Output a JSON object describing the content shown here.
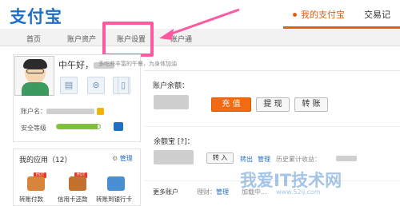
{
  "header": {
    "logo_text": "支付宝",
    "nav_active": "我的支付宝",
    "nav_next": "交易记"
  },
  "subnav": {
    "items": [
      "首页",
      "账户资产",
      "账户设置",
      "账户通"
    ]
  },
  "profile": {
    "greeting": "中午好，",
    "greeting_sub": "多吃些丰富的午餐，为身体加油",
    "account_label": "账户名：",
    "level_label": "安全等级",
    "level_fill": 0.95,
    "icons": [
      "id-card-icon",
      "certificate-icon",
      "shield-icon",
      "phone-icon"
    ]
  },
  "apps": {
    "title": "我的应用（12）",
    "manage": "管理",
    "hot": "HOT",
    "items": [
      {
        "label": "转账付款",
        "color": "#d9843b"
      },
      {
        "label": "信用卡还款",
        "color": "#c2722e"
      },
      {
        "label": "转账到银行卡",
        "color": "#4a8fd1"
      }
    ]
  },
  "balance": {
    "label": "账户余额：",
    "btn_recharge": "充 值",
    "btn_withdraw": "提 现",
    "btn_transfer": "转 账"
  },
  "yuebao": {
    "label": "余额宝 [?]：",
    "btn_in": "转 入",
    "out": "转出",
    "manage": "管理",
    "history": "历史累计收益："
  },
  "more": {
    "label": "更多账户",
    "finance": "理财：",
    "manage": "管理",
    "extra": "加载中..."
  },
  "watermark": {
    "main": "我爱IT技术网",
    "sub": "www.52ij.com"
  },
  "colors": {
    "brand": "#1f6fc4",
    "accent": "#e4600f",
    "highlight": "#ff5aa0"
  }
}
